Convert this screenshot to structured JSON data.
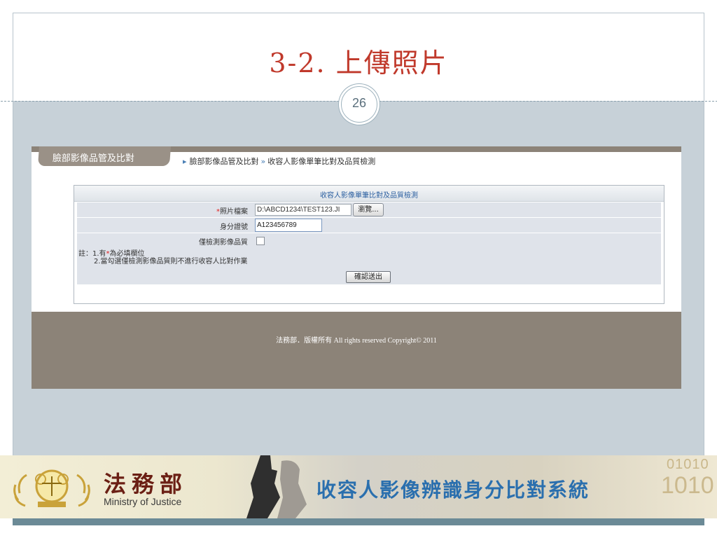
{
  "slide": {
    "title": "3-2. 上傳照片",
    "page_number": "26"
  },
  "app": {
    "tab_label": "臉部影像品管及比對",
    "breadcrumb": {
      "parent": "臉部影像品管及比對",
      "separator": "»",
      "current": "收容人影像單筆比對及品質檢測"
    },
    "form": {
      "header": "收容人影像單筆比對及品質檢測",
      "photo_file_label": "照片檔案",
      "required_mark": "*",
      "photo_file_value": "D:\\ABCD1234\\TEST123.JI",
      "browse_label": "瀏覽...",
      "id_label": "身分證號",
      "id_value": "A123456789",
      "quality_only_label": "僅檢測影像品質",
      "quality_only_checked": false,
      "note_prefix": "註：1.有",
      "note_suffix": "為必填欄位",
      "note_line2": "2.當勾選僅檢測影像品質則不進行收容人比對作業",
      "submit_label": "確認送出"
    },
    "footer": "法務部．版權所有 All rights reserved Copyright© 2011"
  },
  "banner": {
    "org_cn": "法務部",
    "org_en": "Ministry of Justice",
    "system_title": "收容人影像辨識身分比對系統",
    "binary_top": "01010",
    "binary_bottom": "1010"
  },
  "colors": {
    "title_red": "#c0392b",
    "slide_bg": "#c7d1d8",
    "brown_bar": "#8c8378",
    "link_blue": "#2b5fa0",
    "system_blue": "#2a6fae"
  }
}
